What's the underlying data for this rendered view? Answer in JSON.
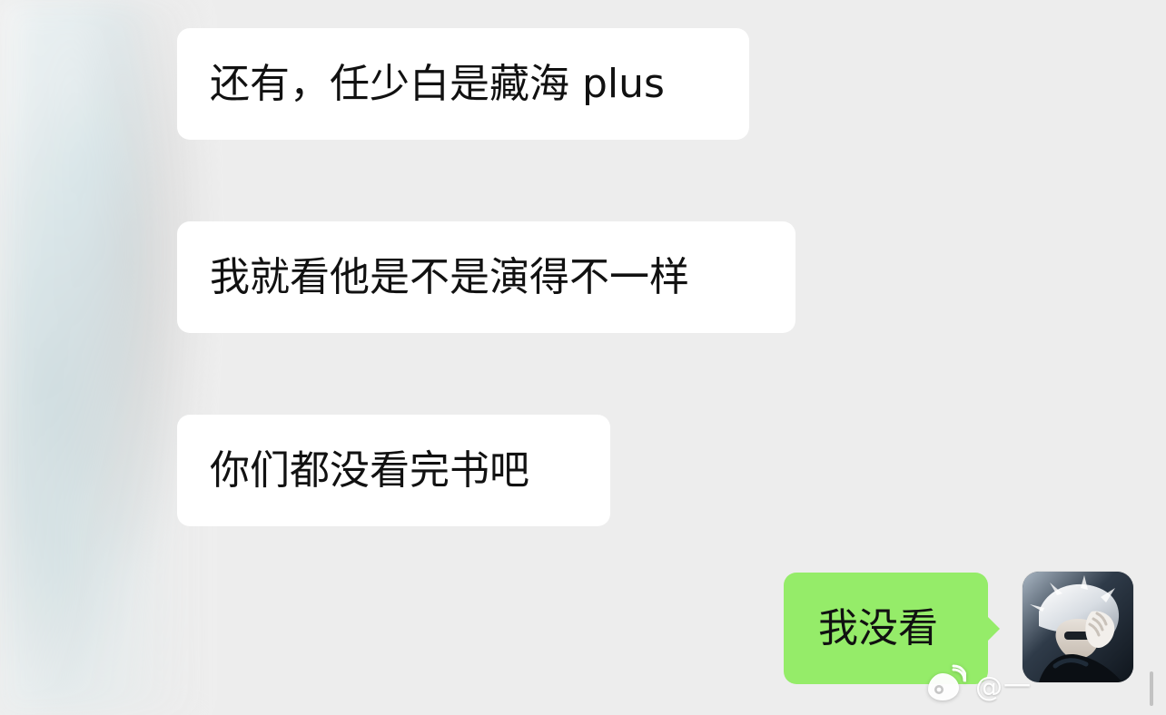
{
  "chat": {
    "messages": [
      {
        "side": "left",
        "sender_name": "",
        "text": "还有，任少白是藏海 plus"
      },
      {
        "side": "left",
        "sender_name": "",
        "text": "我就看他是不是演得不一样"
      },
      {
        "side": "left",
        "sender_name": "",
        "text": "你们都没看完书吧"
      },
      {
        "side": "right",
        "text": "我没看"
      }
    ]
  },
  "ui": {
    "colors": {
      "background": "#ededed",
      "bubble_left": "#ffffff",
      "bubble_right": "#95ec69",
      "text": "#111111"
    },
    "icons": {
      "watermark": "weibo-icon"
    }
  },
  "watermark": {
    "handle": "@一"
  }
}
